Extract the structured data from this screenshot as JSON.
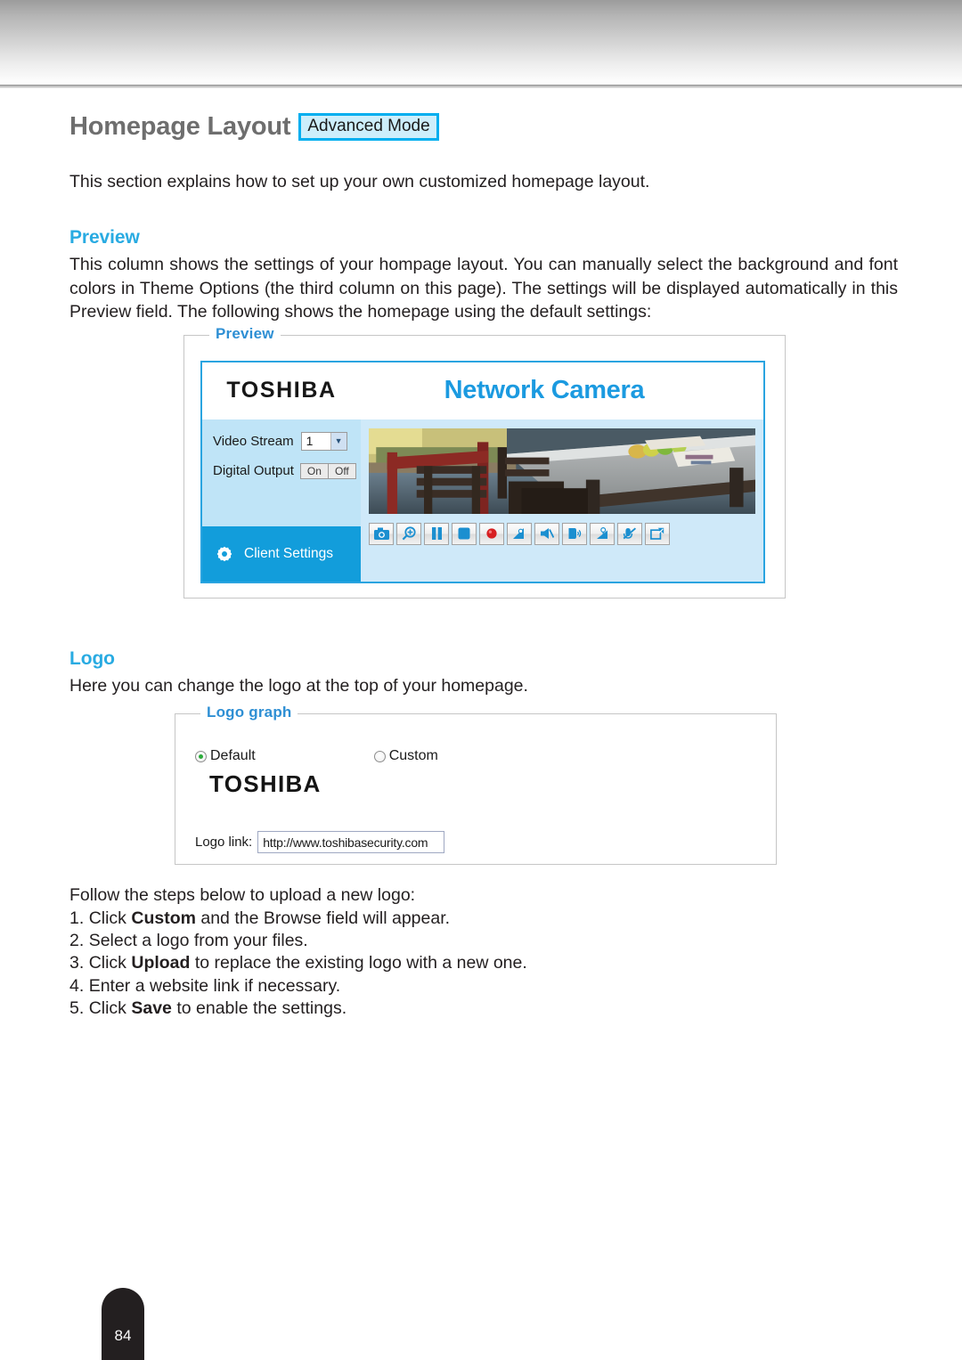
{
  "header": {
    "title": "Homepage Layout",
    "mode_badge": "Advanced Mode"
  },
  "intro": "This section explains how to set up your own customized homepage layout.",
  "preview_section": {
    "heading": "Preview",
    "body": "This column shows the settings of your hompage layout. You can manually select the background and font colors in Theme Options (the third column on this page). The settings will be displayed automatically in this Preview field. The following shows the homepage using the default settings:",
    "panel_legend": "Preview",
    "camera_ui": {
      "brand": "TOSHIBA",
      "title": "Network Camera",
      "video_stream_label": "Video Stream",
      "video_stream_value": "1",
      "digital_output_label": "Digital Output",
      "digital_output_on": "On",
      "digital_output_off": "Off",
      "client_settings_label": "Client Settings",
      "controls": [
        "snapshot-icon",
        "digital-zoom-icon",
        "pause-icon",
        "stop-icon",
        "record-icon",
        "volume-icon",
        "mute-icon",
        "talk-icon",
        "mic-icon",
        "mic-mute-icon",
        "fullscreen-icon"
      ]
    }
  },
  "logo_section": {
    "heading": "Logo",
    "body": "Here you can change the logo at the top of your homepage.",
    "panel_legend": "Logo graph",
    "radio_default": "Default",
    "radio_custom": "Custom",
    "selected_radio": "Default",
    "logo_mark": "TOSHIBA",
    "link_label": "Logo link:",
    "link_value": "http://www.toshibasecurity.com"
  },
  "steps": {
    "intro": "Follow the steps below to upload a new logo:",
    "items": [
      {
        "num": "1. ",
        "pre": "Click ",
        "bold": "Custom",
        "post": " and the Browse field will appear."
      },
      {
        "num": "2. ",
        "pre": "Select a logo from your files.",
        "bold": "",
        "post": ""
      },
      {
        "num": "3. ",
        "pre": "Click ",
        "bold": "Upload",
        "post": " to replace the existing logo with a new one."
      },
      {
        "num": "4. ",
        "pre": "Enter a website link if necessary.",
        "bold": "",
        "post": ""
      },
      {
        "num": "5. ",
        "pre": "Click ",
        "bold": "Save",
        "post": " to enable the settings."
      }
    ]
  },
  "footer": {
    "page_number": "84"
  },
  "colors": {
    "accent_blue": "#29abe2",
    "badge_border": "#00aeef",
    "badge_fill": "#cdeefb",
    "title_gray": "#6e6e6e",
    "camera_blue": "#129ddb",
    "panel_border": "#c6c6c6"
  }
}
